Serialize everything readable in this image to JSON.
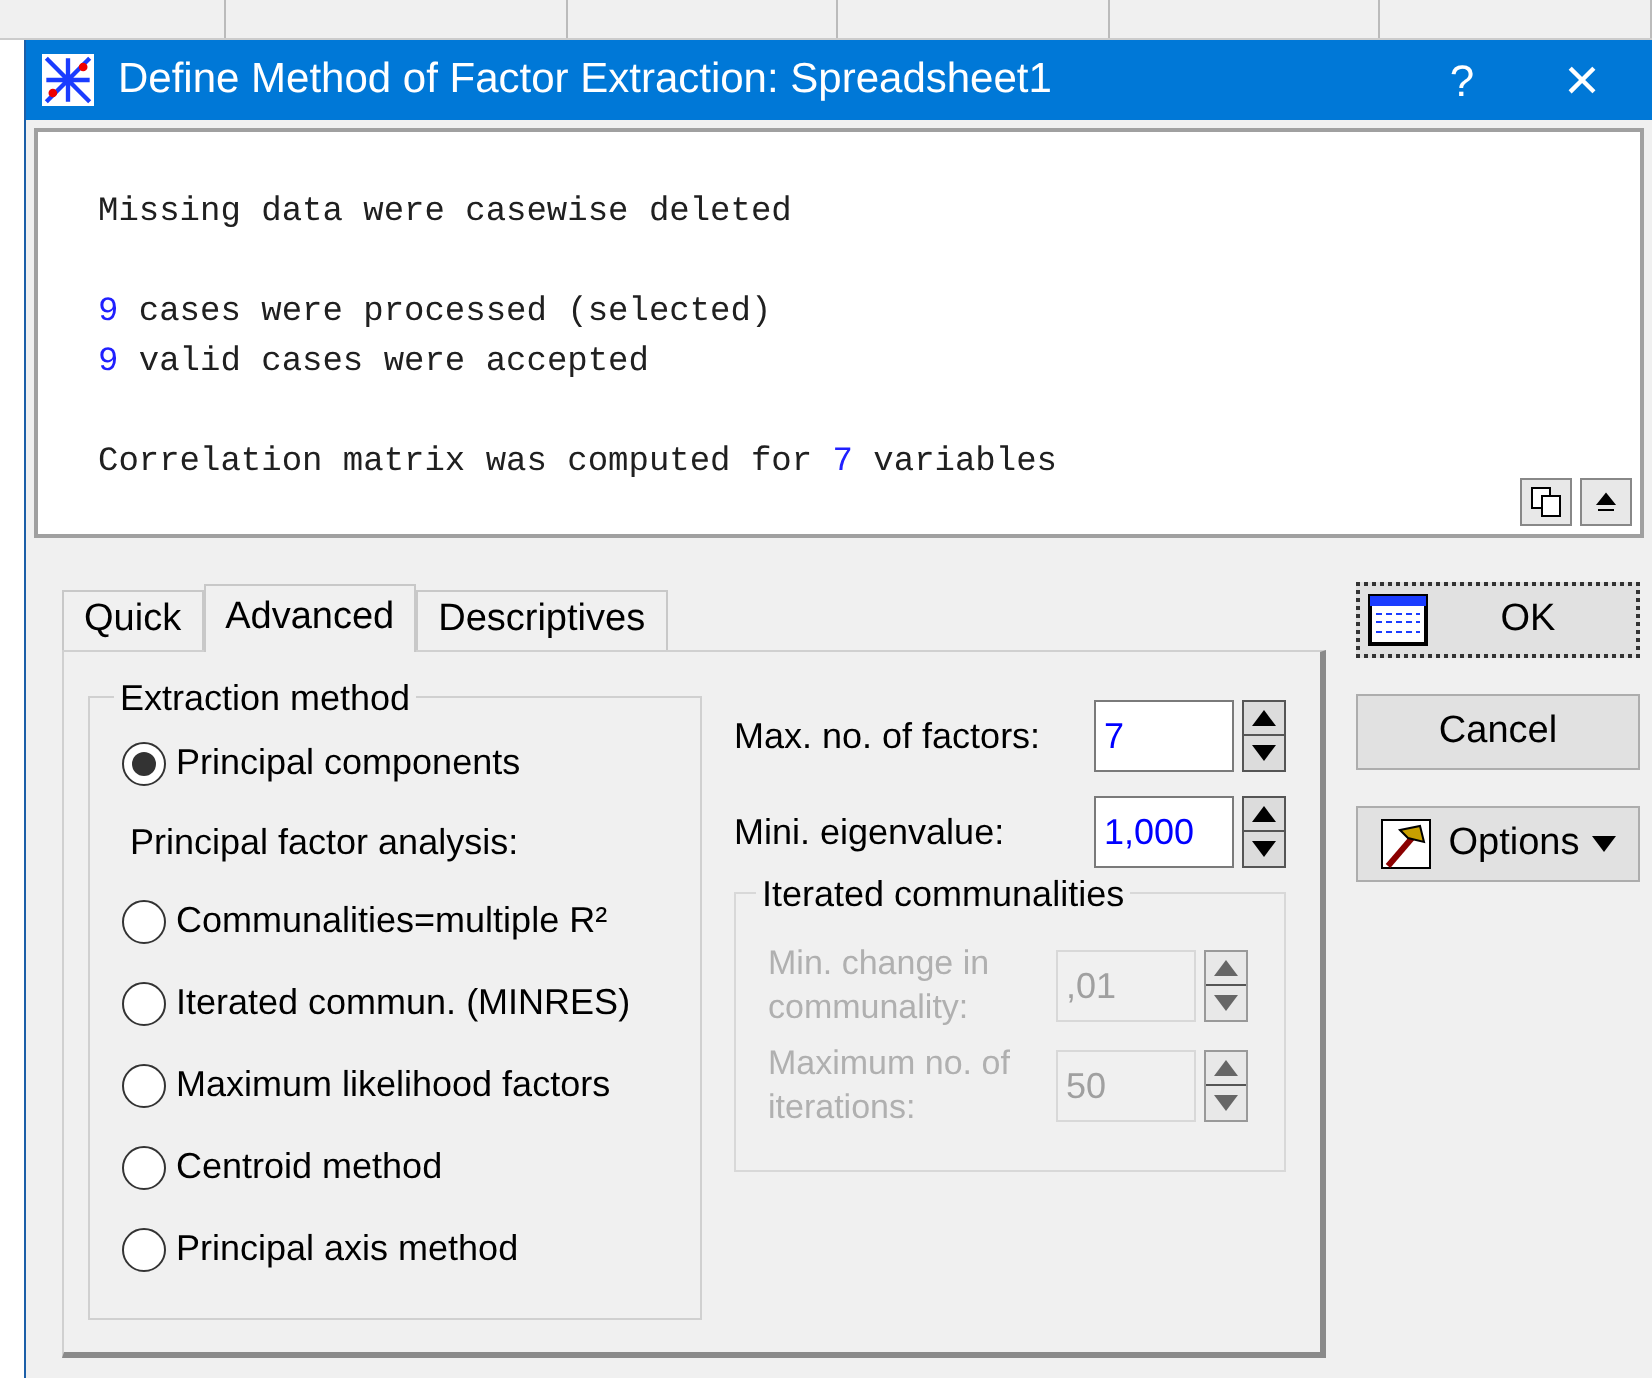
{
  "window": {
    "title": "Define Method of Factor Extraction: Spreadsheet1",
    "help": "?",
    "close": "×"
  },
  "output": {
    "lines": [
      {
        "kind": "text",
        "segments": [
          {
            "text": "Missing data were casewise deleted",
            "highlight": false
          }
        ]
      },
      {
        "kind": "blank"
      },
      {
        "kind": "text",
        "segments": [
          {
            "text": "9",
            "highlight": true
          },
          {
            "text": " cases were processed (selected)",
            "highlight": false
          }
        ]
      },
      {
        "kind": "text",
        "segments": [
          {
            "text": "9",
            "highlight": true
          },
          {
            "text": " valid cases were accepted",
            "highlight": false
          }
        ]
      },
      {
        "kind": "blank"
      },
      {
        "kind": "text",
        "segments": [
          {
            "text": "Correlation matrix was computed for ",
            "highlight": false
          },
          {
            "text": "7",
            "highlight": true
          },
          {
            "text": " variables",
            "highlight": false
          }
        ]
      }
    ]
  },
  "tabs": [
    {
      "label": "Quick",
      "selected": false
    },
    {
      "label": "Advanced",
      "selected": true
    },
    {
      "label": "Descriptives",
      "selected": false
    }
  ],
  "extraction_method": {
    "title": "Extraction method",
    "items": [
      {
        "kind": "radio",
        "label": "Principal components",
        "selected": true
      },
      {
        "kind": "heading",
        "label": "Principal factor analysis:"
      },
      {
        "kind": "radio",
        "label": "Communalities=multiple R²",
        "selected": false
      },
      {
        "kind": "radio",
        "label": "Iterated commun. (MINRES)",
        "selected": false
      },
      {
        "kind": "radio",
        "label": "Maximum likelihood factors",
        "selected": false
      },
      {
        "kind": "radio",
        "label": "Centroid method",
        "selected": false
      },
      {
        "kind": "radio",
        "label": "Principal axis method",
        "selected": false
      }
    ]
  },
  "fields": [
    {
      "label": "Max. no. of factors:",
      "value": "7",
      "disabled": false
    },
    {
      "label": "Mini. eigenvalue:",
      "value": "1,000",
      "disabled": false
    }
  ],
  "iterated": {
    "title": "Iterated communalities",
    "fields": [
      {
        "label": "Min. change in communality:",
        "value": ",01",
        "disabled": true
      },
      {
        "label": "Maximum no. of iterations:",
        "value": "50",
        "disabled": true
      }
    ]
  },
  "buttons": [
    {
      "kind": "ok",
      "label": "OK"
    },
    {
      "kind": "cancel",
      "label": "Cancel"
    },
    {
      "kind": "options",
      "label": "Options"
    }
  ]
}
